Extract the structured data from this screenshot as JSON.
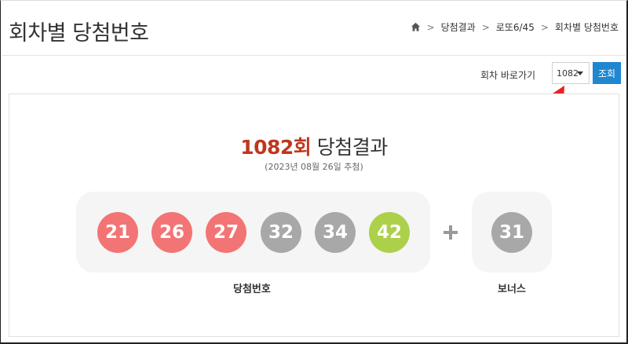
{
  "header": {
    "title": "회차별 당첨번호",
    "breadcrumb": [
      "당첨결과",
      "로또6/45",
      "회차별 당첨번호"
    ]
  },
  "controls": {
    "goto_label": "회차 바로가기",
    "selected_round": "1082",
    "search_label": "조회",
    "search_color": "#1f86d0"
  },
  "result": {
    "round_number": "1082회",
    "title_suffix": "당첨결과",
    "draw_date": "(2023년 08월 26일 추첨)",
    "winning_numbers": [
      {
        "value": "21",
        "color": "#f37474"
      },
      {
        "value": "26",
        "color": "#f37474"
      },
      {
        "value": "27",
        "color": "#f37474"
      },
      {
        "value": "32",
        "color": "#a8a8a8"
      },
      {
        "value": "34",
        "color": "#a8a8a8"
      },
      {
        "value": "42",
        "color": "#acd04a"
      }
    ],
    "bonus_number": {
      "value": "31",
      "color": "#a8a8a8"
    },
    "winning_label": "당첨번호",
    "bonus_label": "보너스"
  }
}
